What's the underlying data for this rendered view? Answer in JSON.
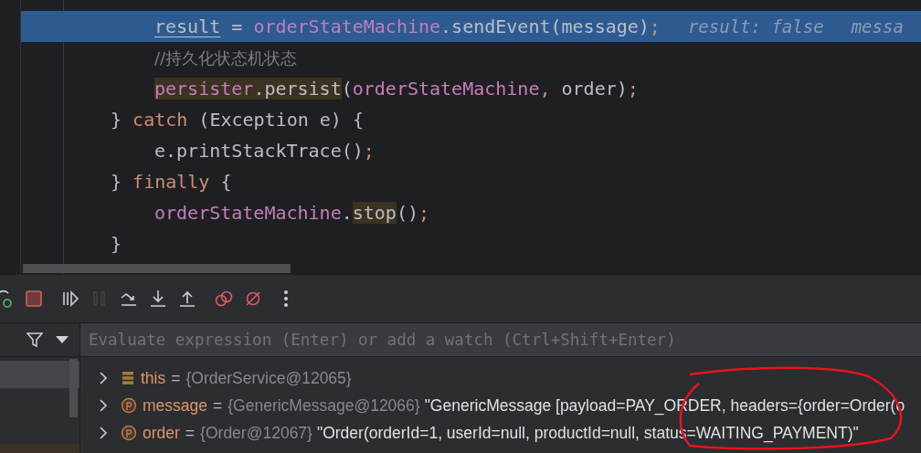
{
  "editor": {
    "lines": [
      {
        "kind": "statement",
        "highlighted": true,
        "tokens": [
          {
            "kind": "local",
            "text": "result"
          },
          {
            "kind": "plain",
            "text": " = "
          },
          {
            "kind": "field",
            "text": "orderStateMachine"
          },
          {
            "kind": "plain",
            "text": ".sendEvent(message)"
          },
          {
            "kind": "semi",
            "text": ";"
          }
        ],
        "debug_values": [
          "result: false",
          "messa"
        ]
      },
      {
        "kind": "statement",
        "highlighted": false,
        "tokens": [
          {
            "kind": "comment",
            "text": "//持久化状态机状态"
          }
        ]
      },
      {
        "kind": "statement",
        "highlighted": false,
        "tokens": [
          {
            "kind": "field_usage",
            "text": "persister"
          },
          {
            "kind": "plain_usage",
            "text": ".persist"
          },
          {
            "kind": "plain",
            "text": "("
          },
          {
            "kind": "field",
            "text": "orderStateMachine"
          },
          {
            "kind": "semi",
            "text": ","
          },
          {
            "kind": "plain",
            "text": " order)"
          },
          {
            "kind": "semi",
            "text": ";"
          }
        ]
      },
      {
        "kind": "brace",
        "highlighted": false,
        "tokens": [
          {
            "kind": "plain",
            "text": "} "
          },
          {
            "kind": "keyword",
            "text": "catch"
          },
          {
            "kind": "plain",
            "text": " (Exception e) {"
          }
        ]
      },
      {
        "kind": "statement",
        "highlighted": false,
        "tokens": [
          {
            "kind": "plain",
            "text": "e.printStackTrace()"
          },
          {
            "kind": "semi",
            "text": ";"
          }
        ]
      },
      {
        "kind": "brace",
        "highlighted": false,
        "tokens": [
          {
            "kind": "plain",
            "text": "} "
          },
          {
            "kind": "keyword",
            "text": "finally"
          },
          {
            "kind": "plain",
            "text": " {"
          }
        ]
      },
      {
        "kind": "statement",
        "highlighted": false,
        "tokens": [
          {
            "kind": "field",
            "text": "orderStateMachine"
          },
          {
            "kind": "plain",
            "text": "."
          },
          {
            "kind": "plain_usage",
            "text": "stop"
          },
          {
            "kind": "plain",
            "text": "()"
          },
          {
            "kind": "semi",
            "text": ";"
          }
        ]
      },
      {
        "kind": "brace",
        "highlighted": false,
        "tokens": [
          {
            "kind": "plain",
            "text": "}"
          }
        ]
      }
    ]
  },
  "debug_toolbar": {
    "buttons": [
      {
        "kind": "rerun",
        "disabled": false
      },
      {
        "kind": "stop",
        "disabled": false
      },
      {
        "kind": "resume",
        "disabled": false
      },
      {
        "kind": "pause",
        "disabled": true
      },
      {
        "kind": "step_over",
        "disabled": false
      },
      {
        "kind": "step_into",
        "disabled": false
      },
      {
        "kind": "step_out",
        "disabled": false
      },
      {
        "kind": "breakpoints",
        "disabled": false
      },
      {
        "kind": "mute",
        "disabled": false
      },
      {
        "kind": "more",
        "disabled": false
      }
    ]
  },
  "evaluate": {
    "placeholder": "Evaluate expression (Enter) or add a watch (Ctrl+Shift+Enter)"
  },
  "frames": {
    "rows": [
      {
        "selected": true
      }
    ]
  },
  "variables": [
    {
      "kind": "object",
      "name": "this",
      "equals": "=",
      "type": "{OrderService@12065}"
    },
    {
      "kind": "param",
      "name": "message",
      "equals": "=",
      "type": "{GenericMessage@12066}",
      "value": "\"GenericMessage [payload=PAY_ORDER, headers={order=Order(o"
    },
    {
      "kind": "param",
      "name": "order",
      "equals": "=",
      "type": "{Order@12067}",
      "value": "\"Order(orderId=1, userId=null, productId=null, status=WAITING_PAYMENT)\""
    }
  ]
}
